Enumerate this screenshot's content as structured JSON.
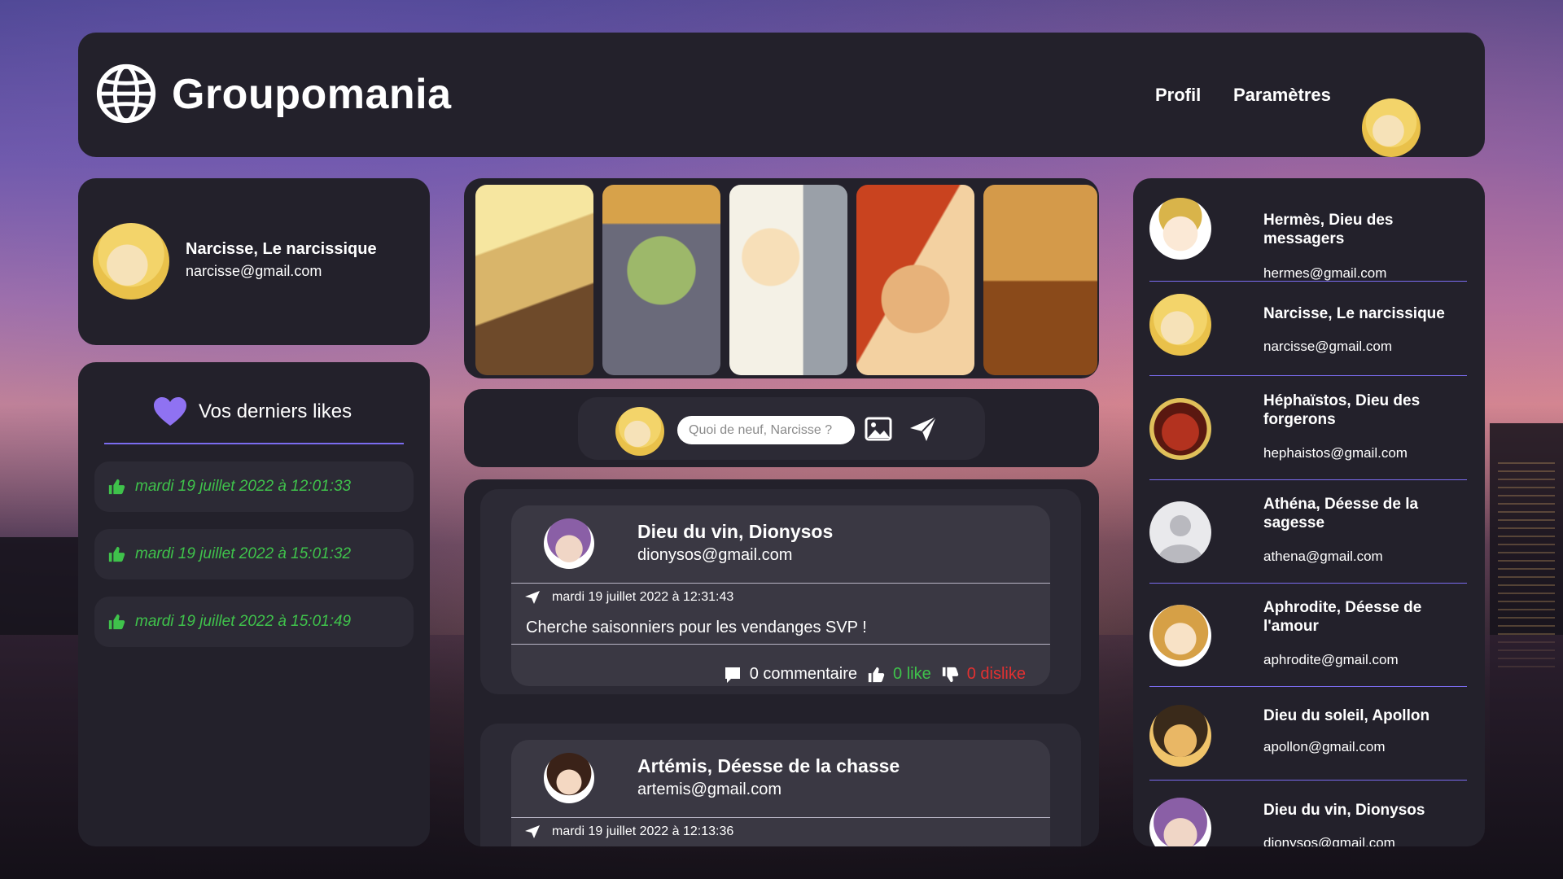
{
  "header": {
    "brand": "Groupomania",
    "nav_profil": "Profil",
    "nav_params": "Paramètres"
  },
  "profile": {
    "name": "Narcisse, Le narcissique",
    "email": "narcisse@gmail.com"
  },
  "likes": {
    "title": "Vos derniers likes",
    "items": [
      "mardi 19 juillet 2022 à 12:01:33",
      "mardi 19 juillet 2022 à 15:01:32",
      "mardi 19 juillet 2022 à 15:01:49"
    ]
  },
  "composer": {
    "placeholder": "Quoi de neuf, Narcisse ?"
  },
  "posts": [
    {
      "author": "Dieu du vin, Dionysos",
      "email": "dionysos@gmail.com",
      "date": "mardi 19 juillet 2022 à 12:31:43",
      "body": "Cherche saisonniers pour les vendanges SVP !",
      "comments": "0 commentaire",
      "likes": "0 like",
      "dislikes": "0 dislike"
    },
    {
      "author": "Artémis, Déesse de la chasse",
      "email": "artemis@gmail.com",
      "date": "mardi 19 juillet 2022 à 12:13:36"
    }
  ],
  "members": [
    {
      "name": "Hermès, Dieu des messagers",
      "email": "hermes@gmail.com"
    },
    {
      "name": "Narcisse, Le narcissique",
      "email": "narcisse@gmail.com"
    },
    {
      "name": "Héphaïstos, Dieu des forgerons",
      "email": "hephaistos@gmail.com"
    },
    {
      "name": "Athéna, Déesse de la sagesse",
      "email": "athena@gmail.com"
    },
    {
      "name": "Aphrodite, Déesse de l'amour",
      "email": "aphrodite@gmail.com"
    },
    {
      "name": "Dieu du soleil, Apollon",
      "email": "apollon@gmail.com"
    },
    {
      "name": "Dieu du vin, Dionysos",
      "email": "dionysos@gmail.com"
    }
  ],
  "colors": {
    "panel": "#23212b",
    "accent": "#7b6cf0",
    "like_green": "#3fc24b",
    "dislike_red": "#e23131"
  }
}
